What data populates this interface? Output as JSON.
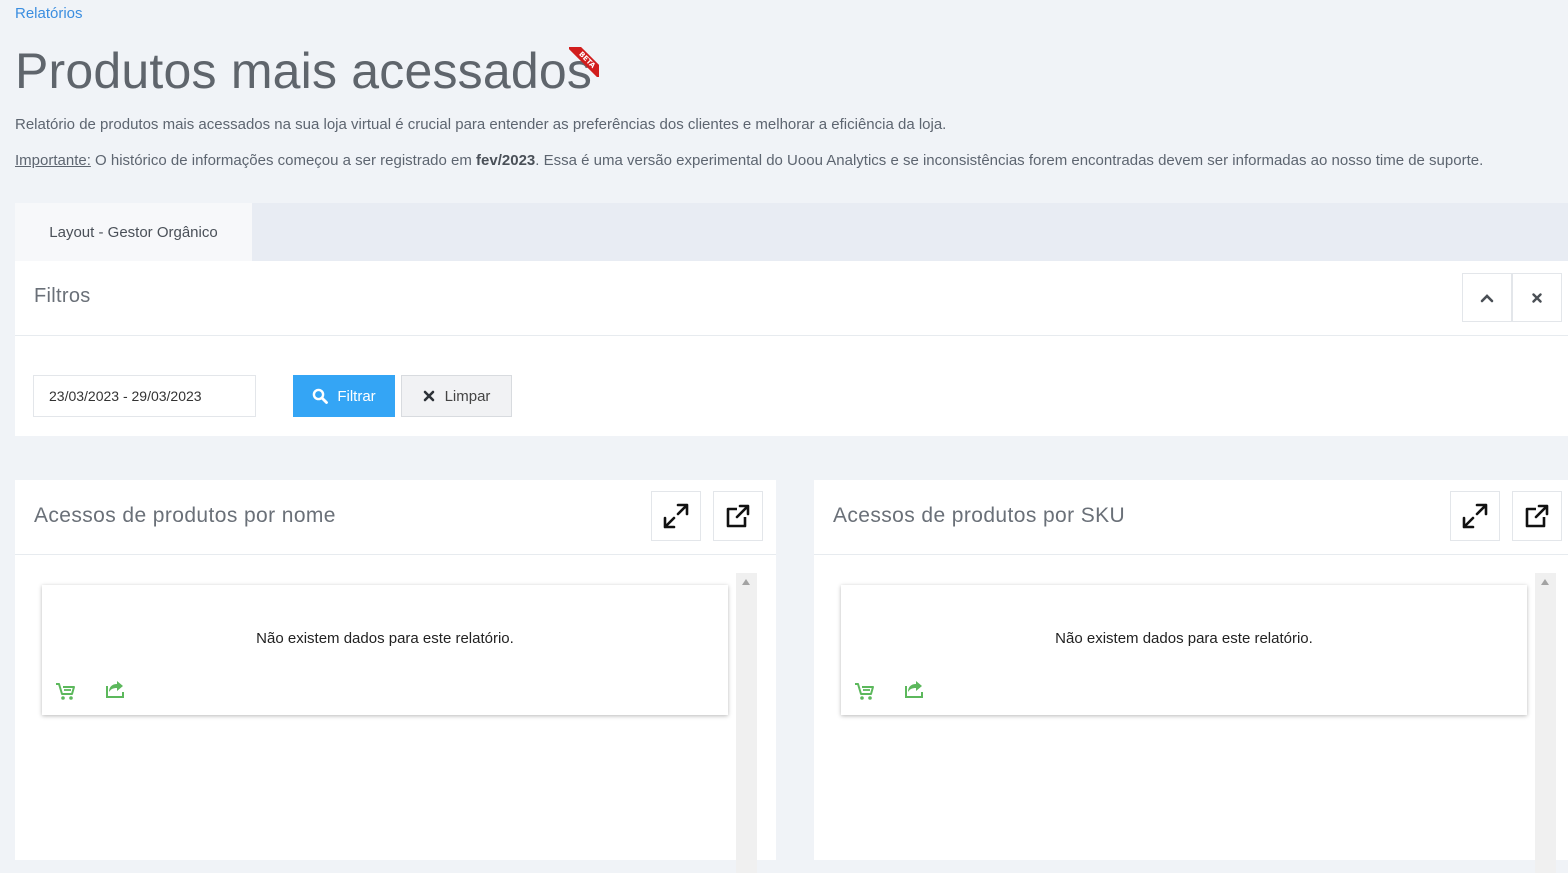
{
  "breadcrumb": "Relatórios",
  "page": {
    "title": "Produtos mais acessados",
    "badge": "BETA",
    "description": "Relatório de produtos mais acessados na sua loja virtual é crucial para entender as preferências dos clientes e melhorar a eficiência da loja.",
    "notice": {
      "label": "Importante:",
      "text_before": " O histórico de informações começou a ser registrado em ",
      "highlight": "fev/2023",
      "text_after": ". Essa é uma versão experimental do Uoou Analytics e se inconsistências forem encontradas devem ser informadas ao nosso time de suporte."
    }
  },
  "tabs": [
    {
      "label": "Layout - Gestor Orgânico",
      "active": true
    }
  ],
  "filters": {
    "title": "Filtros",
    "date_range": "23/03/2023 - 29/03/2023",
    "filter_button": "Filtrar",
    "clear_button": "Limpar"
  },
  "cards": [
    {
      "title": "Acessos de produtos por nome",
      "empty_message": "Não existem dados para este relatório."
    },
    {
      "title": "Acessos de produtos por SKU",
      "empty_message": "Não existem dados para este relatório."
    }
  ],
  "colors": {
    "accent": "#34a5f5",
    "link": "#3b8ee0",
    "icon_green": "#5cb85c",
    "beta_red": "#d11d1d"
  },
  "icons": [
    "search-icon",
    "close-icon",
    "chevron-up-icon",
    "expand-icon",
    "external-link-icon",
    "cart-icon",
    "share-icon"
  ]
}
